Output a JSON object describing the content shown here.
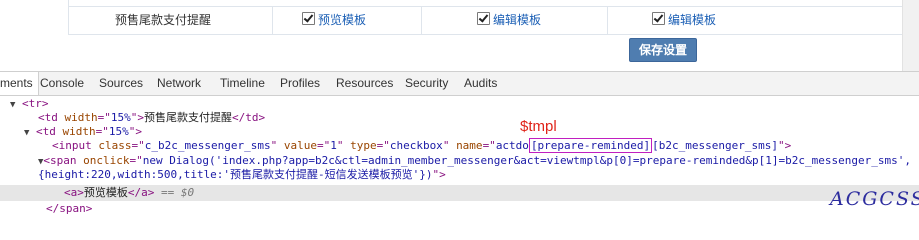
{
  "page": {
    "row": {
      "name": "预售尾款支付提醒",
      "col2_label": "预览模板",
      "col3_label": "编辑模板",
      "col4_label": "编辑模板"
    },
    "save_button": "保存设置"
  },
  "devtools": {
    "tabs": [
      "ments",
      "Console",
      "Sources",
      "Network",
      "Timeline",
      "Profiles",
      "Resources",
      "Security",
      "Audits"
    ],
    "active_tab": "ments"
  },
  "code": {
    "l1_tag": "<tr>",
    "l2_open": "<td ",
    "l2_attr": "width",
    "l2_eq": "=\"",
    "l2_val": "15%",
    "l2_close": "\">",
    "l2_text": "预售尾款支付提醒",
    "l2_end": "</td>",
    "l3_open": "<td ",
    "l3_attr": "width",
    "l3_eq": "=\"",
    "l3_val": "15%",
    "l3_close": "\">",
    "l4_open": "<input ",
    "l4_a1": "class",
    "l4_v1": "c_b2c_messenger_sms",
    "l4_a2": "value",
    "l4_v2": "1",
    "l4_a3": "type",
    "l4_v3": "checkbox",
    "l4_a4": "name",
    "l4_v4_pre": "actdo",
    "l4_v4_hl": "[prepare-reminded]",
    "l4_v4_post": "[b2c_messenger_sms]",
    "l4_close": "\">",
    "l5_open": "<span ",
    "l5_a1": "onclick",
    "l5_v1": "new Dialog('index.php?app=b2c&ctl=admin_member_messenger&act=viewtmpl&p[0]=prepare-reminded&p[1]=b2c_messenger_sms',",
    "l6_v1": "{height:220,width:500,title:'预售尾款支付提醒-短信发送模板预览'})",
    "l6_close": "\">",
    "l7_open": "<a>",
    "l7_text": "预览模板",
    "l7_close": "</a>",
    "l7_eq": " == ",
    "l7_dollar": "$0",
    "l8_tag": "</span>"
  },
  "annotation": "$tmpl",
  "watermark": "ACGCSS",
  "colors": {
    "tag": "#881280",
    "attr": "#994500",
    "value": "#1a1aa6",
    "highlight": "#c01fc0",
    "annotation": "#e0241a",
    "button": "#4f7db0"
  }
}
